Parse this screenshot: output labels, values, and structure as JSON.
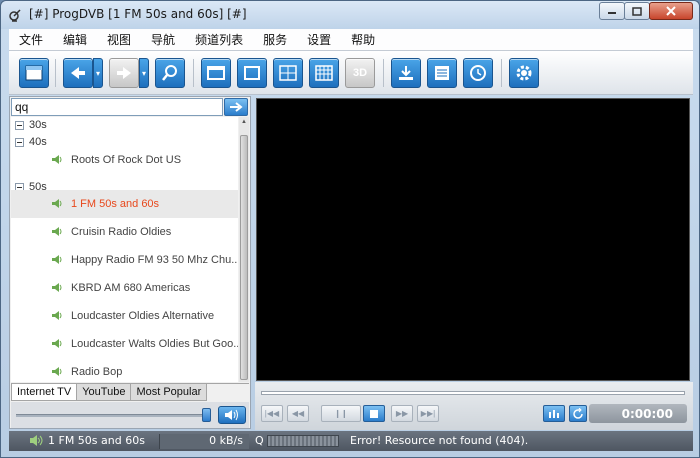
{
  "window": {
    "title": "[#] ProgDVB [1 FM 50s and 60s] [#]"
  },
  "menu": [
    "文件",
    "编辑",
    "视图",
    "导航",
    "频道列表",
    "服务",
    "设置",
    "帮助"
  ],
  "toolbar": {
    "buttons": [
      "channel-list-icon",
      "back-icon",
      "forward-icon",
      "search-icon",
      "window-mode-icon",
      "fullscreen-icon",
      "grid-icon",
      "mosaic-icon",
      "3d-icon",
      "record-icon",
      "epg-list-icon",
      "scheduler-icon",
      "settings-gear-icon"
    ],
    "label_3d": "3D"
  },
  "search": {
    "value": "qq"
  },
  "tree": {
    "groups": {
      "g30": "30s",
      "g40": "40s",
      "g50": "50s"
    },
    "channels_40s": [
      "Roots Of Rock Dot US"
    ],
    "channels_50s": [
      "1 FM 50s and 60s",
      "Cruisin Radio Oldies",
      "Happy Radio FM 93 50 Mhz Chu...",
      "KBRD AM 680 Americas",
      "Loudcaster Oldies Alternative",
      "Loudcaster Walts Oldies But Goo...",
      "Radio Bop"
    ],
    "selected": "1 FM 50s and 60s",
    "selected_color": "#e8481c"
  },
  "tabs": [
    "Internet TV",
    "YouTube",
    "Most Popular"
  ],
  "player": {
    "time": "0:00:00"
  },
  "status": {
    "channel": "1 FM 50s and 60s",
    "rate": "0 kB/s",
    "q_label": "Q",
    "message": "Error! Resource not found (404)."
  }
}
